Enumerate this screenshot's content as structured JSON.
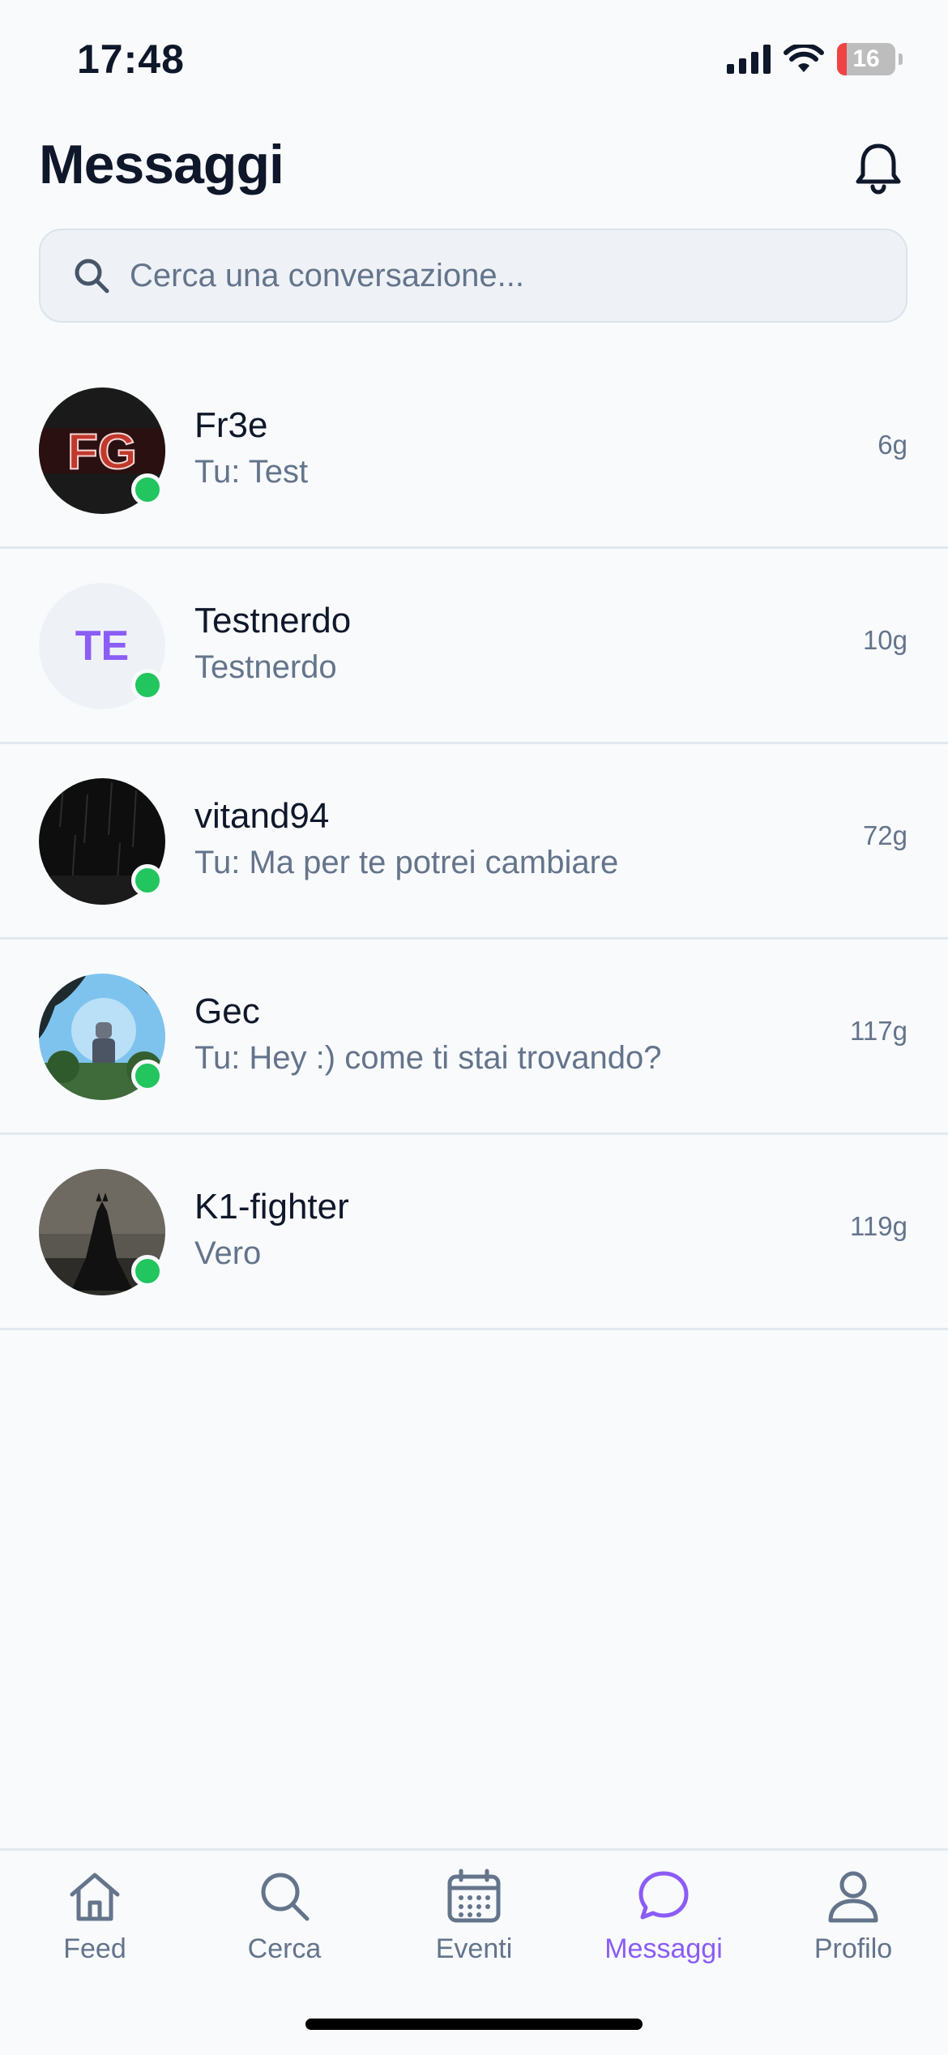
{
  "status_bar": {
    "time": "17:48",
    "battery": "16",
    "battery_level": 0.16
  },
  "header": {
    "title": "Messaggi"
  },
  "search": {
    "placeholder": "Cerca una conversazione..."
  },
  "conversations": [
    {
      "name": "Fr3e",
      "preview": "Tu: Test",
      "time": "6g",
      "online": true,
      "avatar": "fr3e-logo-avatar",
      "avatar_logo_text": "FG"
    },
    {
      "name": "Testnerdo",
      "preview": "Testnerdo",
      "time": "10g",
      "online": true,
      "avatar_initials": "TE"
    },
    {
      "name": "vitand94",
      "preview": "Tu: Ma per te potrei cambiare",
      "time": "72g",
      "online": true,
      "avatar": "dark-rain-photo"
    },
    {
      "name": "Gec",
      "preview": "Tu: Hey :) come ti stai trovando?",
      "time": "117g",
      "online": true,
      "avatar": "robot-tree-photo"
    },
    {
      "name": "K1-fighter",
      "preview": "Vero",
      "time": "119g",
      "online": true,
      "avatar": "dark-knight-photo"
    }
  ],
  "bottom_nav": [
    {
      "label": "Feed",
      "icon": "home-icon",
      "active": false
    },
    {
      "label": "Cerca",
      "icon": "search-icon",
      "active": false
    },
    {
      "label": "Eventi",
      "icon": "calendar-icon",
      "active": false
    },
    {
      "label": "Messaggi",
      "icon": "chat-bubble-icon",
      "active": true
    },
    {
      "label": "Profilo",
      "icon": "user-icon",
      "active": false
    }
  ],
  "colors": {
    "accent": "#8b5cf6",
    "online": "#22c55e",
    "text": "#0f172a",
    "muted": "#64748b",
    "background": "#f8fafc"
  }
}
